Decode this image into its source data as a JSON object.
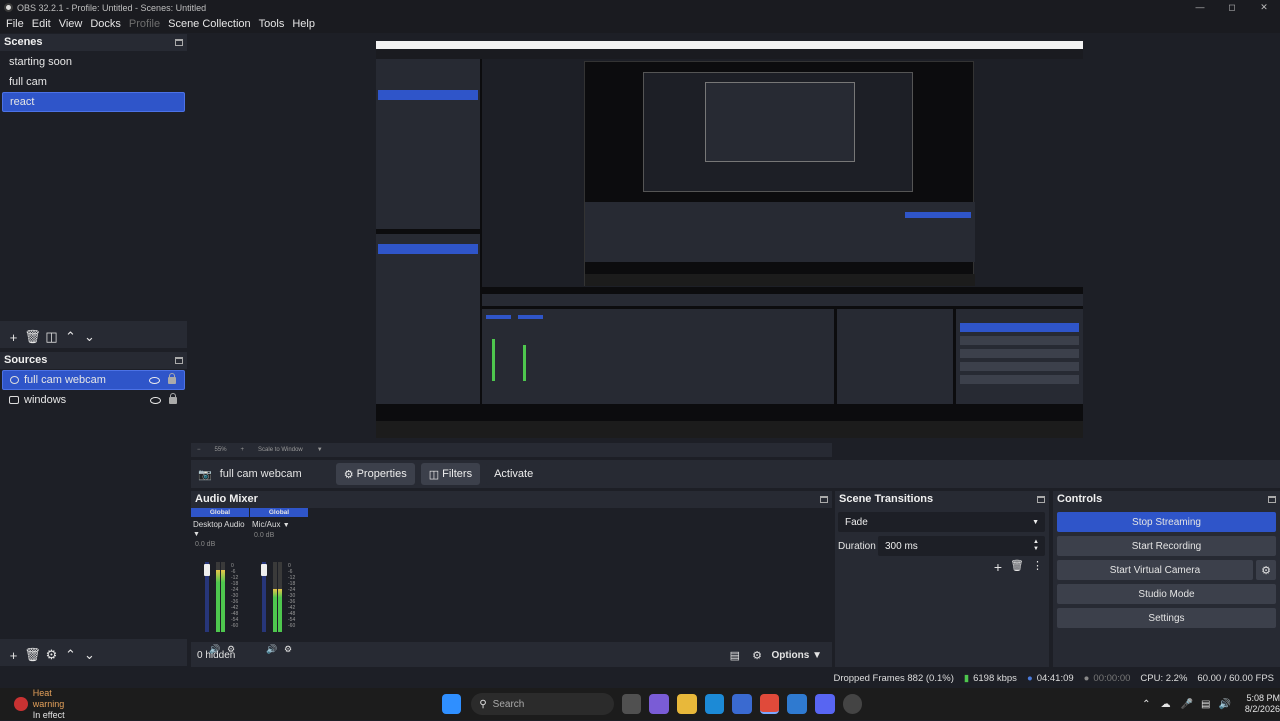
{
  "window": {
    "title": "OBS 32.2.1 - Profile: Untitled - Scenes: Untitled"
  },
  "menu": [
    "File",
    "Edit",
    "View",
    "Docks",
    "Profile",
    "Scene Collection",
    "Tools",
    "Help"
  ],
  "scenes": {
    "title": "Scenes",
    "items": [
      "starting soon",
      "full cam",
      "react"
    ],
    "selected": 2
  },
  "sources": {
    "title": "Sources",
    "items": [
      "full cam webcam",
      "windows"
    ],
    "selected": 0
  },
  "zoom": {
    "percent": "55%",
    "mode": "Scale to Window"
  },
  "context": {
    "source": "full cam webcam",
    "properties": "Properties",
    "filters": "Filters",
    "activate": "Activate"
  },
  "mixer": {
    "title": "Audio Mixer",
    "channels": [
      {
        "global": "Global",
        "name": "Desktop Audio",
        "db": "0.0 dB",
        "level": 0.88
      },
      {
        "global": "Global",
        "name": "Mic/Aux",
        "db": "0.0 dB",
        "level": 0.62
      }
    ],
    "ticks": [
      "0",
      "-6",
      "-12",
      "-18",
      "-24",
      "-30",
      "-36",
      "-42",
      "-48",
      "-54",
      "-60"
    ],
    "hidden": "0 hidden",
    "options": "Options"
  },
  "transitions": {
    "title": "Scene Transitions",
    "type": "Fade",
    "duration_label": "Duration",
    "duration": "300 ms"
  },
  "controls": {
    "title": "Controls",
    "stop_streaming": "Stop Streaming",
    "start_recording": "Start Recording",
    "start_virtual": "Start Virtual Camera",
    "studio_mode": "Studio Mode",
    "settings": "Settings"
  },
  "status": {
    "dropped": "Dropped Frames 882 (0.1%)",
    "kbps": "6198 kbps",
    "stream_time": "04:41:09",
    "rec_time": "00:00:00",
    "cpu": "CPU: 2.2%",
    "fps": "60.00 / 60.00 FPS"
  },
  "taskbar": {
    "warning_title": "Heat warning",
    "warning_sub": "In effect",
    "search": "Search",
    "time": "5:08 PM",
    "date": "8/2/2026"
  },
  "colors": {
    "accent": "#2f55c9",
    "bg": "#1d1f26",
    "panel": "#272a33"
  }
}
